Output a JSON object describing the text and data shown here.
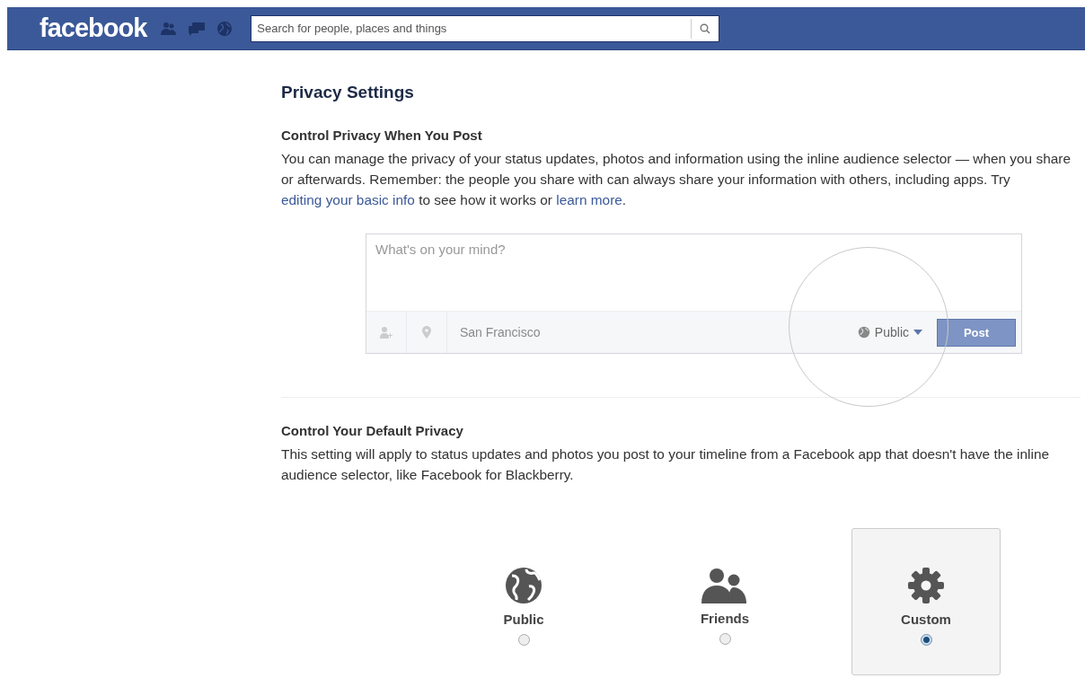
{
  "topbar": {
    "logo": "facebook",
    "search": {
      "placeholder": "Search for people, places and things"
    }
  },
  "title": "Privacy Settings",
  "post_section": {
    "heading": "Control Privacy When You Post",
    "description": [
      {
        "kind": "text",
        "text": "You can manage the privacy of your status updates, photos and information using the inline audience selector — when you share or afterwards. Remember: the people you share with can always share your information with others, including apps. Try "
      },
      {
        "kind": "link",
        "text": "editing your basic info"
      },
      {
        "kind": "text",
        "text": " to see how it works or "
      },
      {
        "kind": "link",
        "text": "learn more"
      },
      {
        "kind": "text",
        "text": "."
      }
    ],
    "composer": {
      "placeholder": "What's on your mind?",
      "location": "San Francisco",
      "audience": "Public",
      "button": "Post"
    }
  },
  "default_section": {
    "heading": "Control Your Default Privacy",
    "description": "This setting will apply to status updates and photos you post to your timeline from a Facebook app that doesn't have the inline audience selector, like Facebook for Blackberry.",
    "options": [
      {
        "kind": "globe",
        "label": "Public",
        "selected": false
      },
      {
        "kind": "people",
        "label": "Friends",
        "selected": false
      },
      {
        "kind": "gear",
        "label": "Custom",
        "selected": true
      }
    ]
  }
}
